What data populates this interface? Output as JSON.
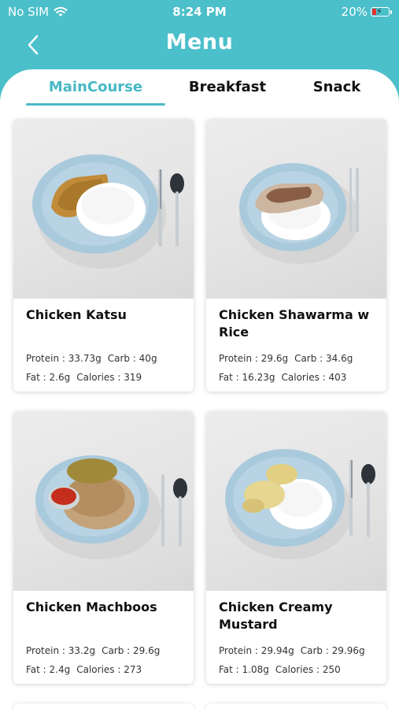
{
  "status_bar": {
    "carrier": "No SIM",
    "time": "8:24 PM",
    "battery": "20%"
  },
  "header": {
    "title": "Menu"
  },
  "tabs": [
    {
      "label": "MainCourse",
      "active": true
    },
    {
      "label": "Breakfast",
      "active": false
    },
    {
      "label": "Snack",
      "active": false
    }
  ],
  "colors": {
    "accent": "#4bbfca",
    "plate": "#a9c9dc",
    "rice": "#ffffff"
  },
  "menu_items": [
    {
      "name": "Chicken Katsu",
      "protein": "Protein : 33.73g",
      "carb": "Carb : 40g",
      "fat": "Fat : 2.6g",
      "calories": "Calories : 319"
    },
    {
      "name": "Chicken Shawarma w Rice",
      "protein": "Protein : 29.6g",
      "carb": "Carb : 34.6g",
      "fat": "Fat : 16.23g",
      "calories": "Calories : 403"
    },
    {
      "name": "Chicken Machboos",
      "protein": "Protein : 33.2g",
      "carb": "Carb : 29.6g",
      "fat": "Fat : 2.4g",
      "calories": "Calories : 273"
    },
    {
      "name": "Chicken Creamy Mustard",
      "protein": "Protein : 29.94g",
      "carb": "Carb : 29.96g",
      "fat": "Fat : 1.08g",
      "calories": "Calories : 250"
    }
  ]
}
